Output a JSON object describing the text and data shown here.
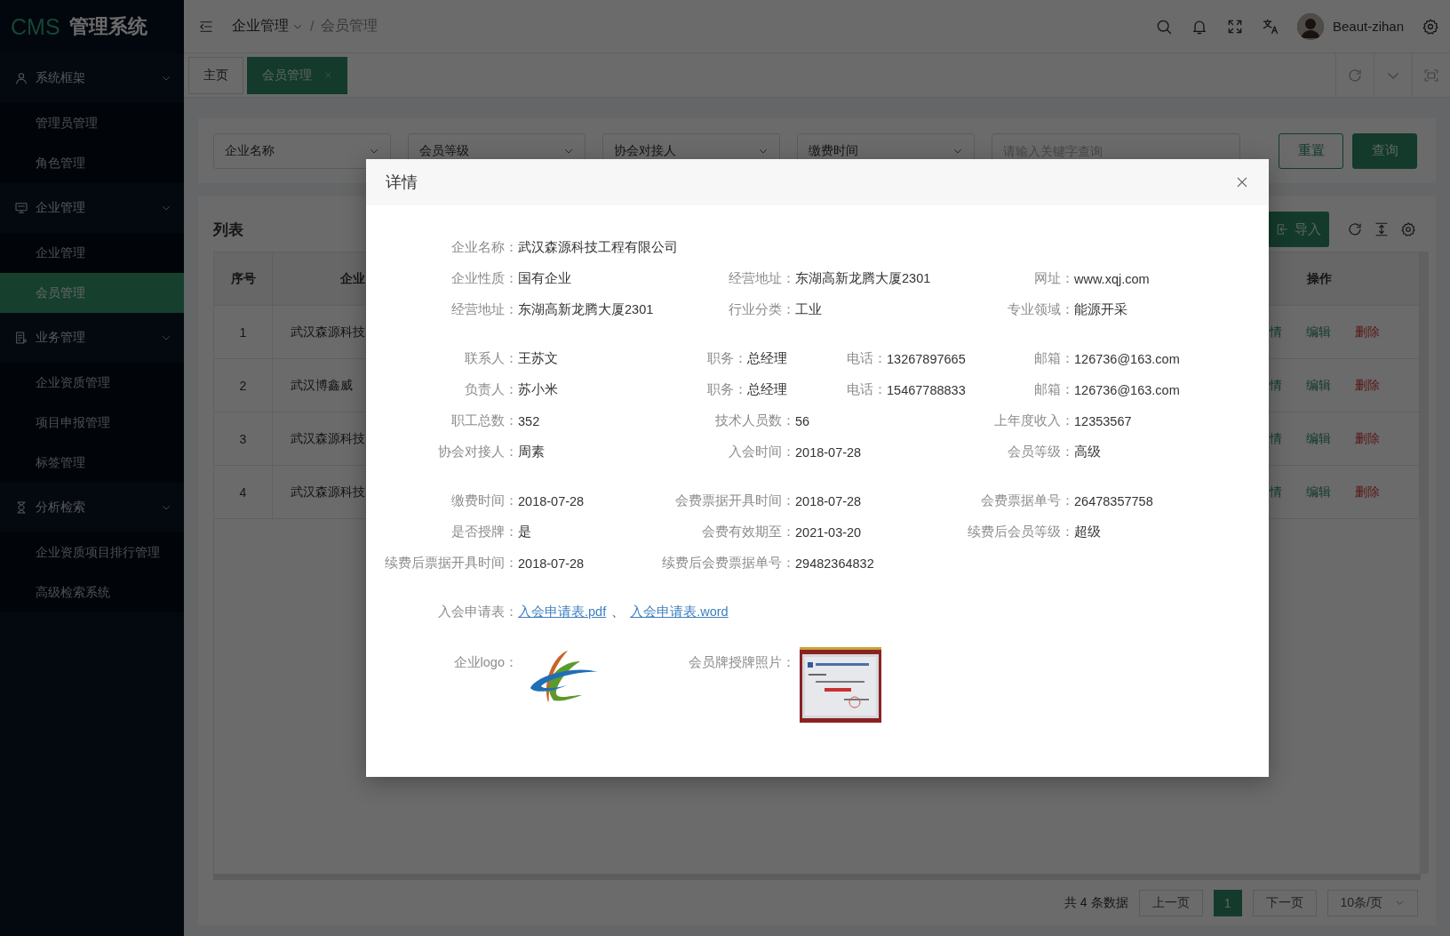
{
  "sidebar": {
    "logo": {
      "accent": "CMS",
      "text": "管理系统"
    },
    "groups": [
      {
        "label": "系统框架",
        "expanded": true,
        "items": [
          {
            "label": "管理员管理",
            "selected": false
          },
          {
            "label": "角色管理",
            "selected": false
          }
        ]
      },
      {
        "label": "企业管理",
        "expanded": true,
        "items": [
          {
            "label": "企业管理",
            "selected": false
          },
          {
            "label": "会员管理",
            "selected": true
          }
        ]
      },
      {
        "label": "业务管理",
        "expanded": true,
        "items": [
          {
            "label": "企业资质管理",
            "selected": false
          },
          {
            "label": "项目申报管理",
            "selected": false
          },
          {
            "label": "标签管理",
            "selected": false
          }
        ]
      },
      {
        "label": "分析检索",
        "expanded": true,
        "items": [
          {
            "label": "企业资质项目排行管理",
            "selected": false
          },
          {
            "label": "高级检索系统",
            "selected": false
          }
        ]
      }
    ]
  },
  "header": {
    "breadcrumb": [
      {
        "label": "企业管理",
        "dropdown": true
      },
      {
        "label": "会员管理",
        "dropdown": false
      }
    ],
    "breadcrumb_separator": "/",
    "user": {
      "name": "Beaut-zihan"
    }
  },
  "tabs": [
    {
      "label": "主页",
      "selected": false,
      "closable": false
    },
    {
      "label": "会员管理",
      "selected": true,
      "closable": true
    }
  ],
  "filters": {
    "selects": [
      {
        "placeholder": "企业名称"
      },
      {
        "placeholder": "会员等级"
      },
      {
        "placeholder": "协会对接人"
      },
      {
        "placeholder": "缴费时间"
      }
    ],
    "search": {
      "placeholder": "请输入关键字查询"
    },
    "buttons": [
      {
        "label": "重置",
        "kind": "outline"
      },
      {
        "label": "查询",
        "kind": "primary"
      }
    ]
  },
  "list": {
    "title": "列表",
    "import_button": "导入",
    "table": {
      "columns": [
        "序号",
        "企业",
        "操作"
      ],
      "rows": [
        {
          "cells": [
            "1",
            "武汉森源科技"
          ],
          "actions": [
            {
              "label": "情",
              "kind": "link"
            },
            {
              "label": "编辑",
              "kind": "link"
            },
            {
              "label": "删除",
              "kind": "danger"
            }
          ]
        },
        {
          "cells": [
            "2",
            "武汉博鑫威"
          ],
          "actions": [
            {
              "label": "情",
              "kind": "link"
            },
            {
              "label": "编辑",
              "kind": "link"
            },
            {
              "label": "删除",
              "kind": "danger"
            }
          ]
        },
        {
          "cells": [
            "3",
            "武汉森源科技"
          ],
          "actions": [
            {
              "label": "情",
              "kind": "link"
            },
            {
              "label": "编辑",
              "kind": "link"
            },
            {
              "label": "删除",
              "kind": "danger"
            }
          ]
        },
        {
          "cells": [
            "4",
            "武汉森源科技"
          ],
          "actions": [
            {
              "label": "情",
              "kind": "link"
            },
            {
              "label": "编辑",
              "kind": "link"
            },
            {
              "label": "删除",
              "kind": "danger"
            }
          ]
        }
      ]
    },
    "pagination": {
      "total": "共 4 条数据",
      "prev": "上一页",
      "pages": [
        {
          "label": "1",
          "selected": true
        }
      ],
      "next": "下一页",
      "page_size": "10条/页"
    }
  },
  "modal": {
    "title": "详情",
    "sections": [
      {
        "rows": [
          [
            {
              "label": "企业名称：",
              "value": "武汉森源科技工程有限公司"
            }
          ],
          [
            {
              "label": "企业性质：",
              "value": "国有企业"
            },
            {
              "label": "经营地址：",
              "value": "东湖高新龙腾大厦2301"
            },
            {
              "label": "网址：",
              "value": "www.xqj.com"
            }
          ],
          [
            {
              "label": "经营地址：",
              "value": "东湖高新龙腾大厦2301"
            },
            {
              "label": "行业分类：",
              "value": "工业"
            },
            {
              "label": "专业领域：",
              "value": "能源开采"
            }
          ]
        ]
      },
      {
        "rows": [
          [
            {
              "label": "联系人：",
              "value": "王苏文"
            },
            {
              "label": "职务：",
              "value": "总经理"
            },
            {
              "label": "电话：",
              "value": "13267897665"
            },
            {
              "label": "邮箱：",
              "value": "126736@163.com"
            }
          ],
          [
            {
              "label": "负责人：",
              "value": "苏小米"
            },
            {
              "label": "职务：",
              "value": "总经理"
            },
            {
              "label": "电话：",
              "value": "15467788833"
            },
            {
              "label": "邮箱：",
              "value": "126736@163.com"
            }
          ],
          [
            {
              "label": "职工总数：",
              "value": "352"
            },
            {
              "label": "技术人员数：",
              "value": "56"
            },
            {
              "label": "上年度收入：",
              "value": "12353567"
            }
          ],
          [
            {
              "label": "协会对接人：",
              "value": "周素"
            },
            {
              "label": "入会时间：",
              "value": "2018-07-28"
            },
            {
              "label": "会员等级：",
              "value": "高级"
            }
          ]
        ]
      },
      {
        "rows": [
          [
            {
              "label": "缴费时间：",
              "value": "2018-07-28"
            },
            {
              "label": "会费票据开具时间：",
              "value": "2018-07-28"
            },
            {
              "label": "会费票据单号：",
              "value": "26478357758"
            }
          ],
          [
            {
              "label": "是否授牌：",
              "value": "是"
            },
            {
              "label": "会费有效期至：",
              "value": "2021-03-20"
            },
            {
              "label": "续费后会员等级：",
              "value": "超级"
            }
          ],
          [
            {
              "label": "续费后票据开具时间：",
              "value": "2018-07-28"
            },
            {
              "label": "续费后会费票据单号：",
              "value": "29482364832"
            }
          ]
        ]
      }
    ],
    "attachments": {
      "label": "入会申请表：",
      "links": [
        "入会申请表.pdf",
        "入会申请表.word"
      ],
      "separator": "、"
    },
    "images": [
      {
        "label": "企业logo：",
        "kind": "logo"
      },
      {
        "label": "会员牌授牌照片：",
        "kind": "picture"
      }
    ]
  }
}
